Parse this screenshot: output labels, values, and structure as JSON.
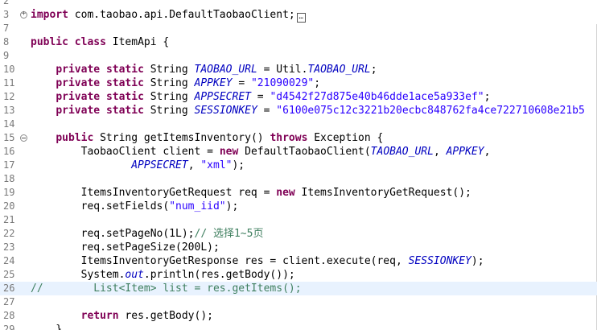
{
  "editor": {
    "colors": {
      "keyword": "#7f0055",
      "string": "#2a00ff",
      "field": "#0000c0",
      "comment": "#3f7f5f",
      "line_number": "#787878",
      "current_line": "#e8f2fe"
    },
    "lines": [
      {
        "n": "2",
        "fold": "",
        "tokens": []
      },
      {
        "n": "3",
        "fold": "plus",
        "tokens": [
          {
            "t": "kw",
            "v": "import"
          },
          {
            "t": "",
            "v": " com.taobao.api.DefaultTaobaoClient;"
          },
          {
            "t": "box",
            "v": "…"
          }
        ]
      },
      {
        "n": "7",
        "fold": "",
        "tokens": []
      },
      {
        "n": "8",
        "fold": "",
        "tokens": [
          {
            "t": "kw",
            "v": "public"
          },
          {
            "t": "",
            "v": " "
          },
          {
            "t": "kw",
            "v": "class"
          },
          {
            "t": "",
            "v": " ItemApi {"
          }
        ]
      },
      {
        "n": "9",
        "fold": "",
        "tokens": []
      },
      {
        "n": "10",
        "fold": "",
        "tokens": [
          {
            "t": "",
            "v": "    "
          },
          {
            "t": "kw",
            "v": "private"
          },
          {
            "t": "",
            "v": " "
          },
          {
            "t": "kw",
            "v": "static"
          },
          {
            "t": "",
            "v": " String "
          },
          {
            "t": "fld",
            "v": "TAOBAO_URL"
          },
          {
            "t": "",
            "v": " = Util."
          },
          {
            "t": "fld",
            "v": "TAOBAO_URL"
          },
          {
            "t": "",
            "v": ";"
          }
        ]
      },
      {
        "n": "11",
        "fold": "",
        "tokens": [
          {
            "t": "",
            "v": "    "
          },
          {
            "t": "kw",
            "v": "private"
          },
          {
            "t": "",
            "v": " "
          },
          {
            "t": "kw",
            "v": "static"
          },
          {
            "t": "",
            "v": " String "
          },
          {
            "t": "fld",
            "v": "APPKEY"
          },
          {
            "t": "",
            "v": " = "
          },
          {
            "t": "str",
            "v": "\"21090029\""
          },
          {
            "t": "",
            "v": ";"
          }
        ]
      },
      {
        "n": "12",
        "fold": "",
        "tokens": [
          {
            "t": "",
            "v": "    "
          },
          {
            "t": "kw",
            "v": "private"
          },
          {
            "t": "",
            "v": " "
          },
          {
            "t": "kw",
            "v": "static"
          },
          {
            "t": "",
            "v": " String "
          },
          {
            "t": "fld",
            "v": "APPSECRET"
          },
          {
            "t": "",
            "v": " = "
          },
          {
            "t": "str",
            "v": "\"d4542f27d875e40b46dde1ace5a933ef\""
          },
          {
            "t": "",
            "v": ";"
          }
        ]
      },
      {
        "n": "13",
        "fold": "",
        "tokens": [
          {
            "t": "",
            "v": "    "
          },
          {
            "t": "kw",
            "v": "private"
          },
          {
            "t": "",
            "v": " "
          },
          {
            "t": "kw",
            "v": "static"
          },
          {
            "t": "",
            "v": " String "
          },
          {
            "t": "fld",
            "v": "SESSIONKEY"
          },
          {
            "t": "",
            "v": " = "
          },
          {
            "t": "str",
            "v": "\"6100e075c12c3221b20ecbc848762fa4ce722710608e21b5"
          }
        ]
      },
      {
        "n": "14",
        "fold": "",
        "tokens": []
      },
      {
        "n": "15",
        "fold": "minus",
        "tokens": [
          {
            "t": "",
            "v": "    "
          },
          {
            "t": "kw",
            "v": "public"
          },
          {
            "t": "",
            "v": " String getItemsInventory() "
          },
          {
            "t": "kw",
            "v": "throws"
          },
          {
            "t": "",
            "v": " Exception {"
          }
        ]
      },
      {
        "n": "16",
        "fold": "",
        "tokens": [
          {
            "t": "",
            "v": "        TaobaoClient client = "
          },
          {
            "t": "kw",
            "v": "new"
          },
          {
            "t": "",
            "v": " DefaultTaobaoClient("
          },
          {
            "t": "fld",
            "v": "TAOBAO_URL"
          },
          {
            "t": "",
            "v": ", "
          },
          {
            "t": "fld",
            "v": "APPKEY"
          },
          {
            "t": "",
            "v": ","
          }
        ]
      },
      {
        "n": "17",
        "fold": "",
        "tokens": [
          {
            "t": "",
            "v": "                "
          },
          {
            "t": "fld",
            "v": "APPSECRET"
          },
          {
            "t": "",
            "v": ", "
          },
          {
            "t": "str",
            "v": "\"xml\""
          },
          {
            "t": "",
            "v": ");"
          }
        ]
      },
      {
        "n": "18",
        "fold": "",
        "tokens": []
      },
      {
        "n": "19",
        "fold": "",
        "tokens": [
          {
            "t": "",
            "v": "        ItemsInventoryGetRequest req = "
          },
          {
            "t": "kw",
            "v": "new"
          },
          {
            "t": "",
            "v": " ItemsInventoryGetRequest();"
          }
        ]
      },
      {
        "n": "20",
        "fold": "",
        "tokens": [
          {
            "t": "",
            "v": "        req.setFields("
          },
          {
            "t": "str",
            "v": "\"num_iid\""
          },
          {
            "t": "",
            "v": ");"
          }
        ]
      },
      {
        "n": "21",
        "fold": "",
        "tokens": []
      },
      {
        "n": "22",
        "fold": "",
        "tokens": [
          {
            "t": "",
            "v": "        req.setPageNo(1L);"
          },
          {
            "t": "cmt",
            "v": "// 选择1~5页"
          }
        ]
      },
      {
        "n": "23",
        "fold": "",
        "tokens": [
          {
            "t": "",
            "v": "        req.setPageSize(200L);"
          }
        ]
      },
      {
        "n": "24",
        "fold": "",
        "tokens": [
          {
            "t": "",
            "v": "        ItemsInventoryGetResponse res = client.execute(req, "
          },
          {
            "t": "fld",
            "v": "SESSIONKEY"
          },
          {
            "t": "",
            "v": ");"
          }
        ]
      },
      {
        "n": "25",
        "fold": "",
        "tokens": [
          {
            "t": "",
            "v": "        System."
          },
          {
            "t": "fld",
            "v": "out"
          },
          {
            "t": "",
            "v": ".println(res.getBody());"
          }
        ]
      },
      {
        "n": "26",
        "fold": "",
        "current": true,
        "tokens": [
          {
            "t": "cmt",
            "v": "//        List<Item> list = res.getItems();"
          }
        ]
      },
      {
        "n": "27",
        "fold": "",
        "tokens": []
      },
      {
        "n": "28",
        "fold": "",
        "tokens": [
          {
            "t": "",
            "v": "        "
          },
          {
            "t": "kw",
            "v": "return"
          },
          {
            "t": "",
            "v": " res.getBody();"
          }
        ]
      },
      {
        "n": "29",
        "fold": "",
        "tokens": [
          {
            "t": "",
            "v": "    }"
          }
        ]
      }
    ]
  }
}
